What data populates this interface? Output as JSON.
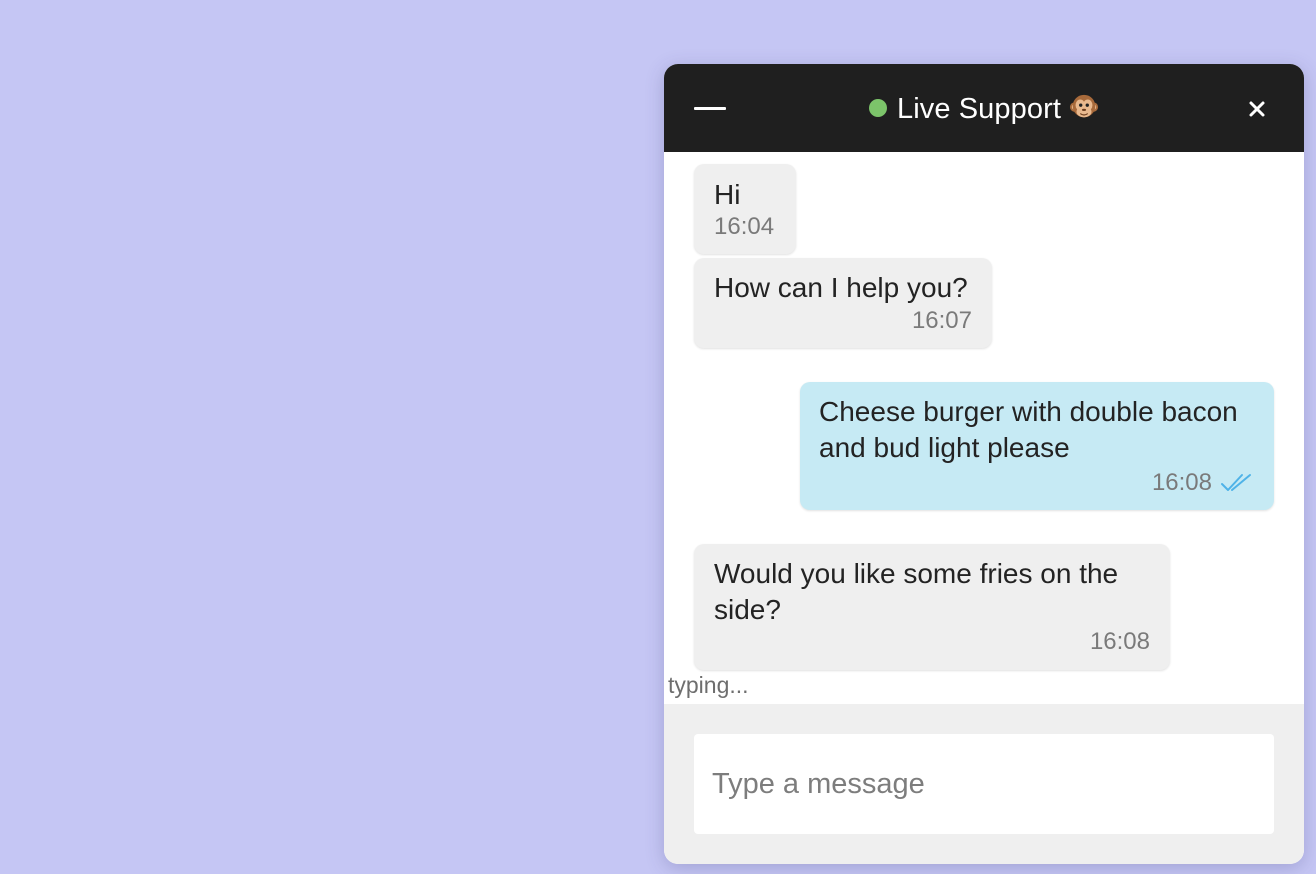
{
  "header": {
    "title": "Live Support",
    "status_color": "#7cc46a",
    "minimize_icon": "minimize-icon",
    "close_icon": "close-icon",
    "mascot_icon": "monkey-face-icon"
  },
  "messages": [
    {
      "sender": "agent",
      "text": "Hi",
      "time": "16:04"
    },
    {
      "sender": "agent",
      "text": "How can I help you?",
      "time": "16:07"
    },
    {
      "sender": "user",
      "text": "Cheese burger with double bacon and bud light please",
      "time": "16:08",
      "status_icon": "double-check-icon"
    },
    {
      "sender": "agent",
      "text": "Would you like some fries on the side?",
      "time": "16:08"
    }
  ],
  "typing_indicator": "typing...",
  "composer": {
    "placeholder": "Type a message",
    "value": ""
  },
  "colors": {
    "background": "#c5c6f4",
    "header": "#1f1f1f",
    "agent_bubble": "#efefef",
    "user_bubble": "#c6eaf4",
    "read_receipt": "#4fb3e8"
  }
}
